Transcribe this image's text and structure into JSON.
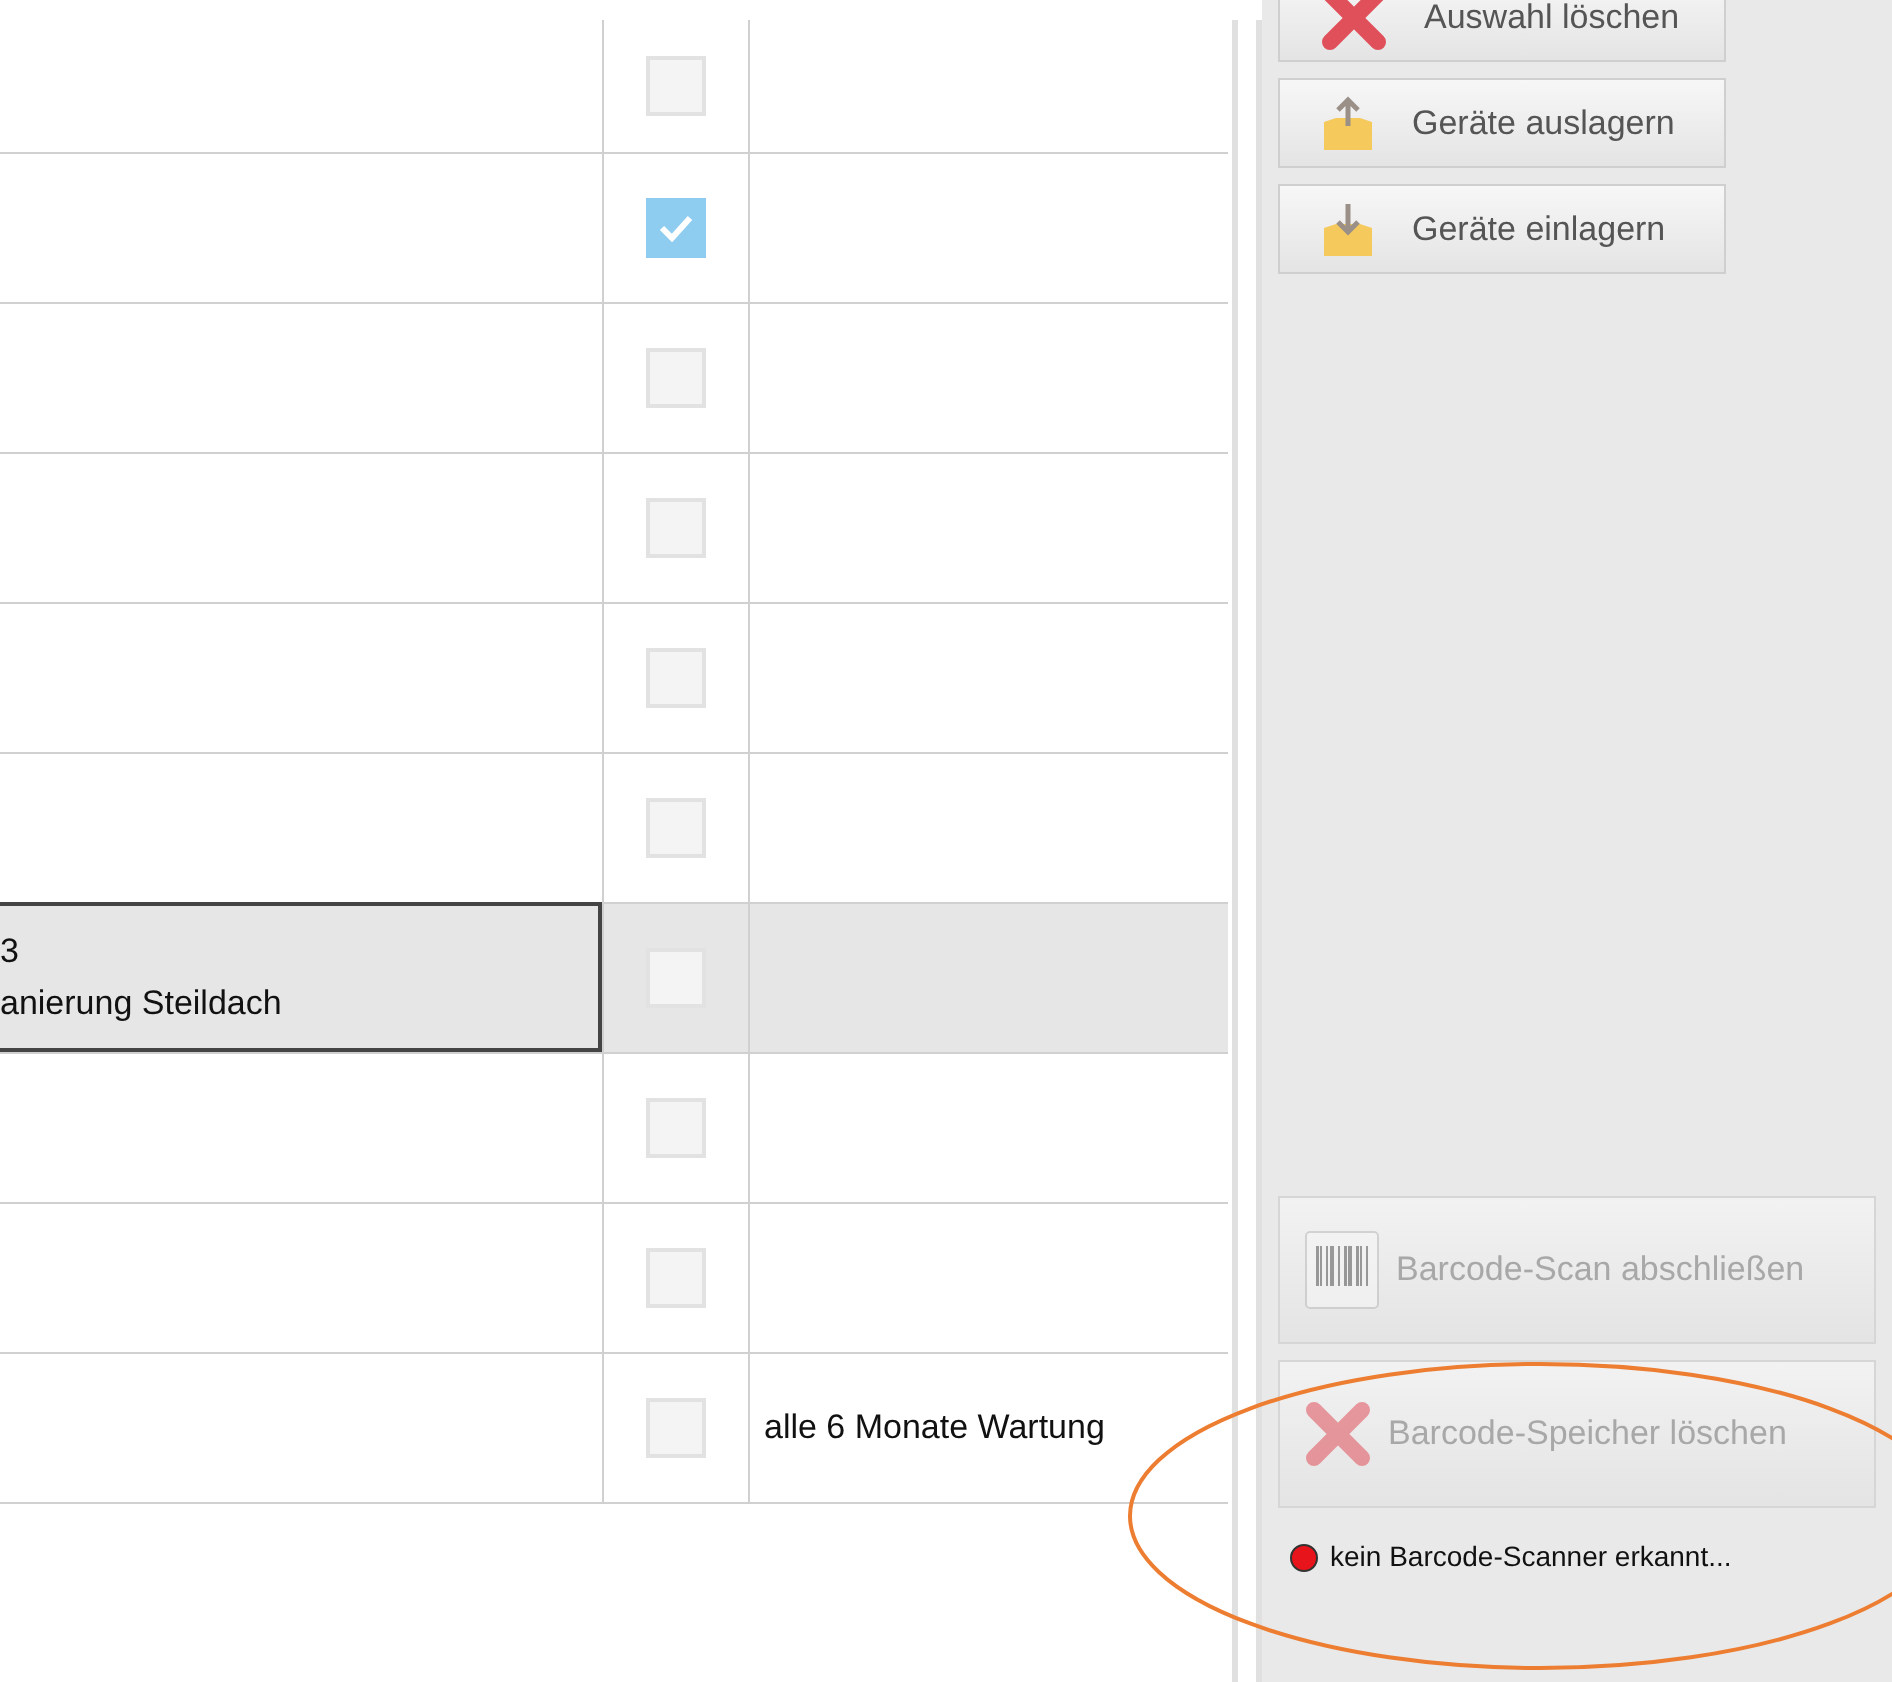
{
  "table": {
    "rows": [
      {
        "column_1": [],
        "checked": false,
        "selected": false,
        "column_3": ""
      },
      {
        "column_1": [],
        "checked": true,
        "selected": false,
        "column_3": ""
      },
      {
        "column_1": [],
        "checked": false,
        "selected": false,
        "column_3": ""
      },
      {
        "column_1": [],
        "checked": false,
        "selected": false,
        "column_3": ""
      },
      {
        "column_1": [],
        "checked": false,
        "selected": false,
        "column_3": ""
      },
      {
        "column_1": [],
        "checked": false,
        "selected": false,
        "column_3": ""
      },
      {
        "column_1": [
          "3",
          "anierung Steildach"
        ],
        "checked": false,
        "selected": true,
        "column_3": ""
      },
      {
        "column_1": [],
        "checked": false,
        "selected": false,
        "column_3": ""
      },
      {
        "column_1": [],
        "checked": false,
        "selected": false,
        "column_3": ""
      },
      {
        "column_1": [],
        "checked": false,
        "selected": false,
        "column_3": "alle 6 Monate Wartung"
      }
    ]
  },
  "actions": [
    {
      "label": "Auswahl löschen",
      "kind": "cross",
      "disabled": false
    },
    {
      "label": "Geräte auslagern",
      "kind": "box-up",
      "disabled": false
    },
    {
      "label": "Geräte einlagern",
      "kind": "box-down",
      "disabled": false
    }
  ],
  "barcode_actions": [
    {
      "label": "Barcode-Scan abschließen",
      "kind": "barcode",
      "disabled": true
    },
    {
      "label": "Barcode-Speicher löschen",
      "kind": "cross",
      "disabled": true
    }
  ],
  "scanner_status": {
    "text": "kein Barcode-Scanner erkannt...",
    "color": "#e8141b"
  },
  "annotation": {
    "kind": "ellipse",
    "color": "#ed7d31"
  }
}
